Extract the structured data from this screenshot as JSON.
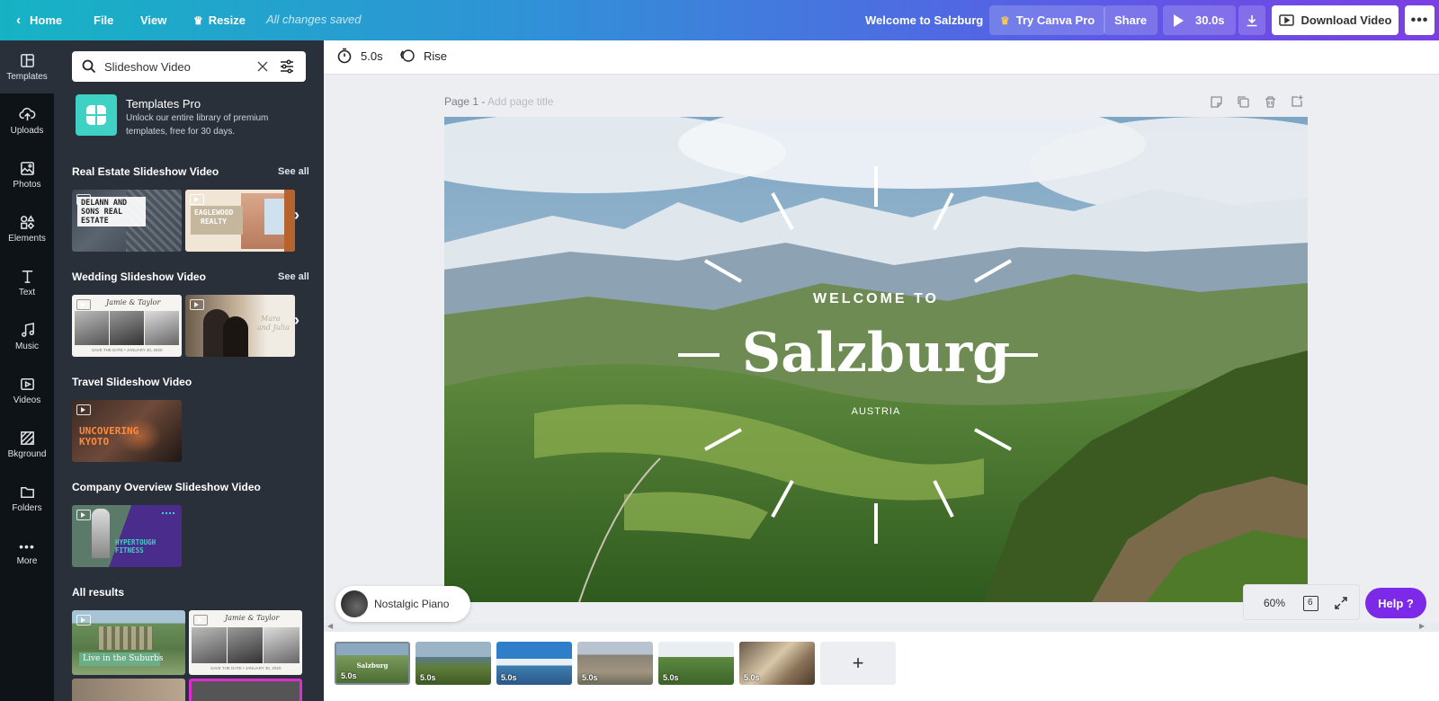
{
  "topbar": {
    "home_label": "Home",
    "file_label": "File",
    "view_label": "View",
    "resize_label": "Resize",
    "save_status": "All changes saved",
    "design_title": "Welcome to Salzburg",
    "try_pro_label": "Try Canva Pro",
    "share_label": "Share",
    "play_duration": "30.0s",
    "download_video_label": "Download Video"
  },
  "leftnav": [
    {
      "label": "Templates",
      "icon": "templates-icon"
    },
    {
      "label": "Uploads",
      "icon": "upload-icon"
    },
    {
      "label": "Photos",
      "icon": "photo-icon"
    },
    {
      "label": "Elements",
      "icon": "shapes-icon"
    },
    {
      "label": "Text",
      "icon": "text-icon"
    },
    {
      "label": "Music",
      "icon": "music-icon"
    },
    {
      "label": "Videos",
      "icon": "video-icon"
    },
    {
      "label": "Bkground",
      "icon": "background-icon"
    },
    {
      "label": "Folders",
      "icon": "folder-icon"
    },
    {
      "label": "More",
      "icon": "more-icon"
    }
  ],
  "panel": {
    "search_value": "Slideshow Video",
    "promo_title": "Templates Pro",
    "promo_text_1": "Unlock our entire library of premium",
    "promo_text_2": "templates, free for 30 days.",
    "see_all": "See all",
    "sections": [
      {
        "title": "Real Estate Slideshow Video"
      },
      {
        "title": "Wedding Slideshow Video"
      },
      {
        "title": "Travel Slideshow Video"
      },
      {
        "title": "Company Overview Slideshow Video"
      },
      {
        "title": "All results"
      }
    ],
    "thumbs": {
      "re1_title_1": "DELANN AND",
      "re1_title_2": "SONS REAL",
      "re1_title_3": "ESTATE",
      "re2_title_1": "EAGLEWOOD",
      "re2_title_2": "REALTY",
      "w1_title": "Jamie & Taylor",
      "w1_footer": "SAVE THE DATE • JANUARY 30, 2020",
      "w2_title_1": "Mara",
      "w2_title_2": "and Julia",
      "t1_title_1": "UNCOVERING",
      "t1_title_2": "KYOTO",
      "c1_title_1": "HYPERTOUGH",
      "c1_title_2": "FITNESS",
      "r1_caption": "Live in the Suburbs",
      "r2_title": "Jamie & Taylor",
      "r2_footer": "SAVE THE DATE • JANUARY 30, 2020"
    }
  },
  "toolbar": {
    "duration": "5.0s",
    "animation": "Rise"
  },
  "canvas": {
    "page_label": "Page 1 -",
    "page_title_placeholder": "Add page title",
    "welcome": "WELCOME TO",
    "city": "Salzburg",
    "country": "AUSTRIA"
  },
  "audio": {
    "track": "Nostalgic Piano"
  },
  "zoom": {
    "level": "60%",
    "page_count": "6"
  },
  "help_label": "Help ?",
  "filmstrip": [
    {
      "duration": "5.0s",
      "scene": "Salzburg"
    },
    {
      "duration": "5.0s"
    },
    {
      "duration": "5.0s"
    },
    {
      "duration": "5.0s"
    },
    {
      "duration": "5.0s"
    },
    {
      "duration": "5.0s"
    }
  ],
  "colors": {
    "accent_purple": "#7d2ae8",
    "teal": "#00c4cc",
    "panel_bg": "#293039",
    "nav_bg": "#0e1318"
  }
}
